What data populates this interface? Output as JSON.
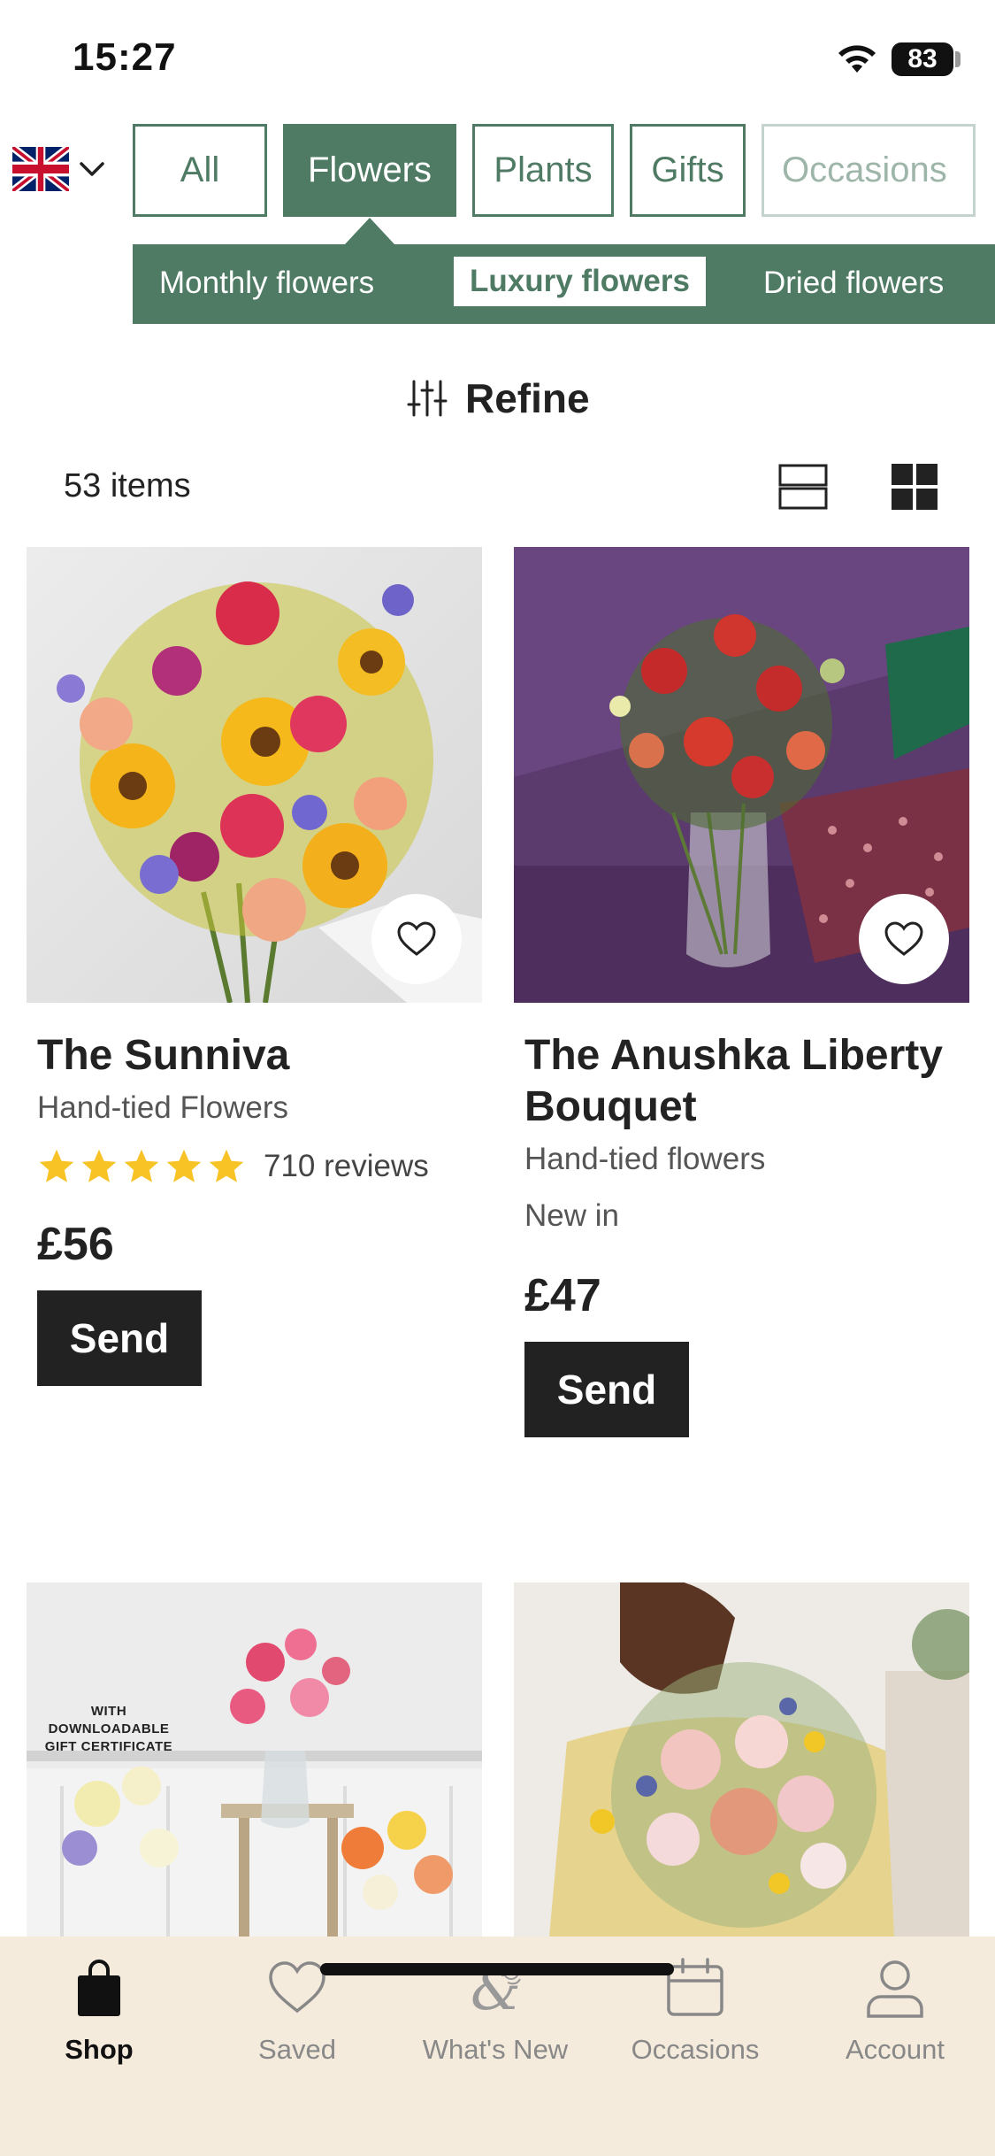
{
  "status": {
    "time": "15:27",
    "battery": "83"
  },
  "categories": [
    {
      "label": "All",
      "active": false
    },
    {
      "label": "Flowers",
      "active": true
    },
    {
      "label": "Plants",
      "active": false
    },
    {
      "label": "Gifts",
      "active": false
    },
    {
      "label": "Occasions",
      "active": false
    }
  ],
  "subcategories": [
    {
      "label": "Monthly flowers",
      "selected": false
    },
    {
      "label": "Luxury flowers",
      "selected": true
    },
    {
      "label": "Dried flowers",
      "selected": false
    }
  ],
  "refine": {
    "label": "Refine"
  },
  "results": {
    "count_label": "53 items"
  },
  "products": [
    {
      "name": "The Sunniva",
      "type": "Hand-tied Flowers",
      "rating_stars": 5,
      "reviews": "710 reviews",
      "price": "£56",
      "cta": "Send"
    },
    {
      "name": "The Anushka Liberty Bouquet",
      "name_line1": "The Anushka Liberty",
      "name_line2": "Bouquet",
      "type": "Hand-tied flowers",
      "badge": "New in",
      "price": "£47",
      "cta": "Send"
    }
  ],
  "image_overlay": {
    "certificate_text": "WITH DOWNLOADABLE GIFT CERTIFICATE"
  },
  "bottom_nav": [
    {
      "label": "Shop",
      "icon": "shopping-bag-icon",
      "active": true
    },
    {
      "label": "Saved",
      "icon": "heart-icon",
      "active": false
    },
    {
      "label": "What's New",
      "icon": "ampersand-floral-icon",
      "active": false
    },
    {
      "label": "Occasions",
      "icon": "calendar-icon",
      "active": false
    },
    {
      "label": "Account",
      "icon": "person-icon",
      "active": false
    }
  ],
  "colors": {
    "brand_green": "#4f7b65",
    "nav_bg": "#f5ebdc",
    "star_yellow": "#f7c325",
    "button_dark": "#222222"
  }
}
